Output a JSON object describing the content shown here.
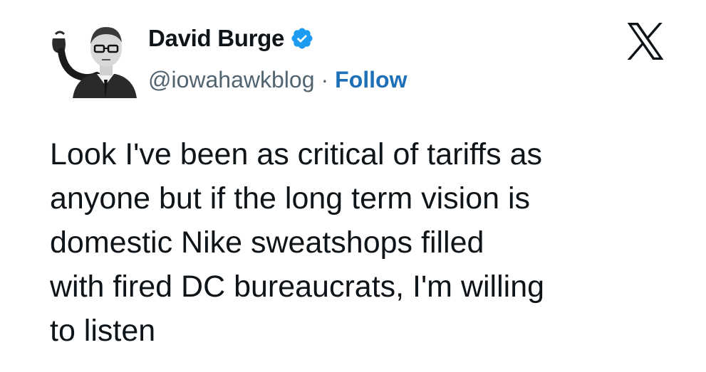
{
  "tweet": {
    "author": {
      "display_name": "David Burge",
      "handle": "@iowahawkblog",
      "verified_icon": "verified-badge-icon",
      "avatar_icon": "avatar"
    },
    "follow_label": "Follow",
    "separator": "·",
    "text": "Look I've been as critical of tariffs as\nanyone but if the long term vision is\ndomestic Nike sweatshops filled\nwith fired DC bureaucrats, I'm willing\nto listen",
    "platform_icon": "x-logo-icon"
  },
  "colors": {
    "text": "#0f1419",
    "secondary": "#536471",
    "link": "#1d6fb8",
    "verified": "#1d9bf0",
    "background": "#ffffff"
  }
}
